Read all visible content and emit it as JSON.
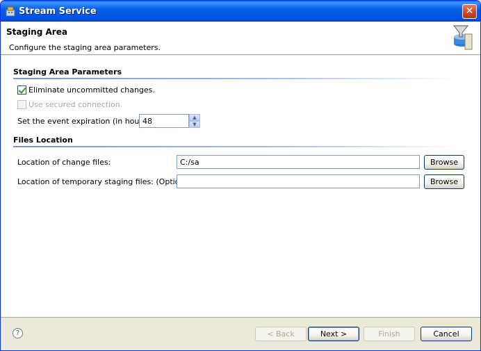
{
  "window": {
    "title": "Stream Service",
    "close_glyph": "✕"
  },
  "header": {
    "title": "Staging Area",
    "description": "Configure the staging area parameters."
  },
  "staging": {
    "section_title": "Staging Area Parameters",
    "eliminate_label": "Eliminate uncommitted changes.",
    "eliminate_checked": true,
    "secured_label": "Use secured connection.",
    "secured_checked": false,
    "expiration_label": "Set the event expiration (in hours).",
    "expiration_value": "48"
  },
  "files": {
    "section_title": "Files Location",
    "change_label": "Location of change files:",
    "change_value": "C:/sa",
    "temp_label": "Location of temporary staging  files: (Optional)",
    "temp_value": "",
    "browse_label": "Browse"
  },
  "footer": {
    "help_glyph": "?",
    "back_label": "< Back",
    "next_label": "Next >",
    "finish_label": "Finish",
    "cancel_label": "Cancel"
  },
  "icons": {
    "app": "stream-service-icon",
    "banner": "database-filter-icon",
    "help": "help-icon"
  }
}
